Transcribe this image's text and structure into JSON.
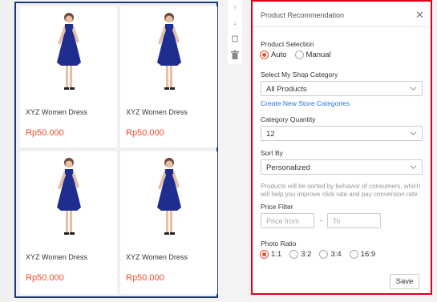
{
  "products": [
    {
      "name": "XYZ Women Dress",
      "price": "Rp50.000"
    },
    {
      "name": "XYZ Women Dress",
      "price": "Rp50.000"
    },
    {
      "name": "XYZ Women Dress",
      "price": "Rp50.000"
    },
    {
      "name": "XYZ Women Dress",
      "price": "Rp50.000"
    }
  ],
  "tools": [
    "arrow-up-icon",
    "arrow-down-icon",
    "copy-icon",
    "trash-icon"
  ],
  "panel": {
    "title": "Product Recommendation",
    "product_selection_label": "Product Selection",
    "selection_options": [
      "Auto",
      "Manual"
    ],
    "selected_selection": "Auto",
    "category_label": "Select My Shop Category",
    "category_value": "All Products",
    "create_link": "Create New Store Categories",
    "quantity_label": "Category Quantity",
    "quantity_value": "12",
    "sort_label": "Sort By",
    "sort_value": "Personalized",
    "sort_hint": "Products will be sorted by behavior of consumers, which will help you improve click rate and pay conversion rate",
    "price_filter_label": "Price Filter",
    "price_from_placeholder": "Price from",
    "price_to_placeholder": "To",
    "price_separator": "-",
    "ratio_label": "Photo Ratio",
    "ratio_options": [
      "1:1",
      "3:2",
      "3:4",
      "16:9"
    ],
    "selected_ratio": "1:1",
    "save_label": "Save"
  },
  "colors": {
    "accent": "#ee4d2d",
    "link": "#2673dd",
    "dress": "#1f2d8f",
    "grid_border": "#1a3a78",
    "panel_border": "#e0001a"
  }
}
